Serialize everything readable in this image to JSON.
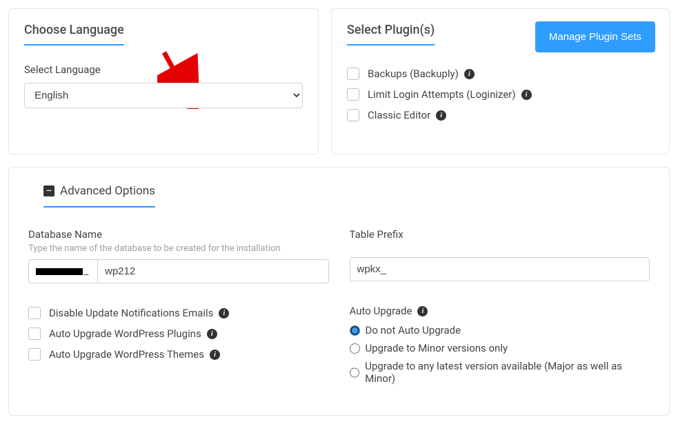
{
  "language": {
    "title": "Choose Language",
    "label": "Select Language",
    "value": "English"
  },
  "plugins": {
    "title": "Select Plugin(s)",
    "manage_button": "Manage Plugin Sets",
    "items": [
      {
        "label": "Backups (Backuply)",
        "info": true
      },
      {
        "label": "Limit Login Attempts (Loginizer)",
        "info": true
      },
      {
        "label": "Classic Editor",
        "info": true
      }
    ]
  },
  "advanced": {
    "title": "Advanced Options",
    "database": {
      "label": "Database Name",
      "hint": "Type the name of the database to be created for the installation",
      "prefix_suffix": "_",
      "value": "wp212"
    },
    "table_prefix": {
      "label": "Table Prefix",
      "value": "wpkx_"
    },
    "checks": [
      {
        "label": "Disable Update Notifications Emails"
      },
      {
        "label": "Auto Upgrade WordPress Plugins"
      },
      {
        "label": "Auto Upgrade WordPress Themes"
      }
    ],
    "auto_upgrade": {
      "label": "Auto Upgrade",
      "options": [
        {
          "label": "Do not Auto Upgrade",
          "checked": true
        },
        {
          "label": "Upgrade to Minor versions only",
          "checked": false
        },
        {
          "label": "Upgrade to any latest version available (Major as well as Minor)",
          "checked": false
        }
      ]
    }
  }
}
